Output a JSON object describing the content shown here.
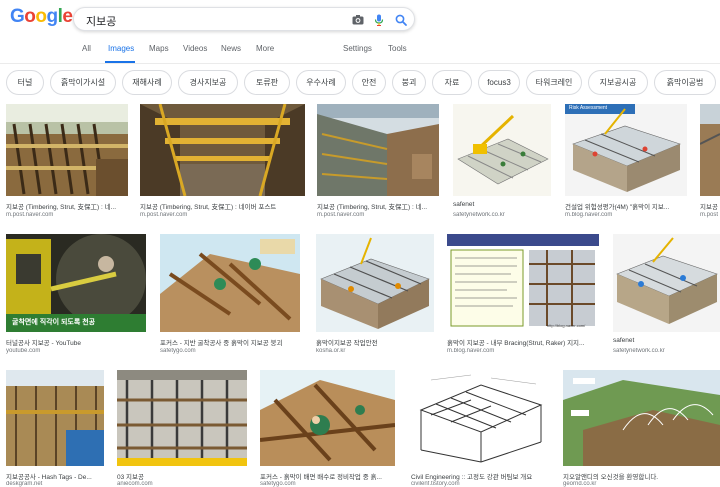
{
  "search": {
    "query": "지보공"
  },
  "logo": {
    "letters": [
      "G",
      "o",
      "o",
      "g",
      "l",
      "e"
    ],
    "colors": [
      "#4285f4",
      "#ea4335",
      "#fbbc05",
      "#4285f4",
      "#34a853",
      "#ea4335"
    ]
  },
  "tabs": {
    "all": "All",
    "images": "Images",
    "maps": "Maps",
    "videos": "Videos",
    "news": "News",
    "more": "More",
    "settings": "Settings",
    "tools": "Tools"
  },
  "chips": [
    "터널",
    "흙막이가시설",
    "재해사례",
    "경사지보공",
    "토류판",
    "우수사례",
    "안전",
    "붕괴",
    "자료",
    "focus3",
    "타워크레인",
    "지보공시공",
    "흙막이공법"
  ],
  "results": [
    {
      "title": "지보공 (Timbering, Strut, 支保工) : 네...",
      "source": "m.post.naver.com"
    },
    {
      "title": "지보공 (Timbering, Strut, 支保工) : 네이버 포스트",
      "source": "m.post.naver.com"
    },
    {
      "title": "지보공 (Timbering, Strut, 支保工) : 네...",
      "source": "m.post.naver.com"
    },
    {
      "title": "safenet",
      "source": "safetynetwork.co.kr"
    },
    {
      "title": "건설업 위험성평가(4M) \"흙막이 지보...",
      "source": "m.blog.naver.com"
    },
    {
      "title": "지보공",
      "source": "m.post"
    },
    {
      "title": "터널공사 지보공 - YouTube",
      "source": "youtube.com"
    },
    {
      "title": "포커스 - 지반 굴착공사 중 흙막이 지보공 붕괴",
      "source": "safetygo.com"
    },
    {
      "title": "흙막이지보공 작업안전",
      "source": "kosha.or.kr"
    },
    {
      "title": "흙막이 지보공 - 내부 Bracing(Strut, Raker) 지지...",
      "source": "m.blog.naver.com"
    },
    {
      "title": "safenet",
      "source": "safetynetwork.co.kr"
    },
    {
      "title": "지보공공사 - Hash Tags - De...",
      "source": "deskgram.net"
    },
    {
      "title": "03 지보공",
      "source": "aniecom.com"
    },
    {
      "title": "포커스 - 흙막이 배면 배수로 정비작업 중 흙...",
      "source": "safetygo.com"
    },
    {
      "title": "Civil Engineering :: 고정도 강관 버팀보 개요",
      "source": "civilenf.tistory.com"
    },
    {
      "title": "지오알앤디의 오신것을 환영합니다.",
      "source": "geornd.co.kr"
    }
  ],
  "thumbnail_texts": {
    "tunnel_caption": "굴착면에 직각이 되도록 천공",
    "risk_header": "Risk Assessment",
    "blog_url": "http://blog.naver.com/"
  }
}
